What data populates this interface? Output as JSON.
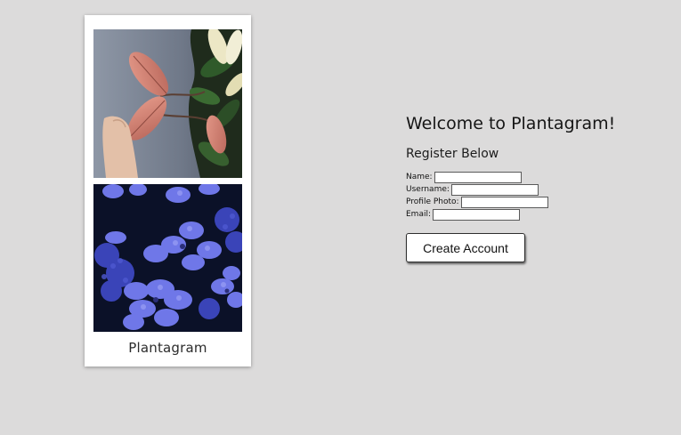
{
  "card": {
    "caption": "Plantagram",
    "photos": [
      {
        "subject": "plant-with-pink-leaves",
        "colors": [
          "#7c8696",
          "#c47a6a",
          "#2f4a2c"
        ]
      },
      {
        "subject": "blue-hydrangea-flowers",
        "colors": [
          "#0c1230",
          "#5a63d8",
          "#8f95f0"
        ]
      }
    ]
  },
  "register": {
    "title": "Welcome to Plantagram!",
    "subtitle": "Register Below",
    "fields": [
      {
        "label": "Name:",
        "value": ""
      },
      {
        "label": "Username:",
        "value": ""
      },
      {
        "label": "Profile Photo:",
        "value": ""
      },
      {
        "label": "Email:",
        "value": ""
      }
    ],
    "submit_label": "Create Account"
  },
  "colors": {
    "background": "#dcdbdb",
    "card": "#ffffff",
    "text": "#161616"
  }
}
